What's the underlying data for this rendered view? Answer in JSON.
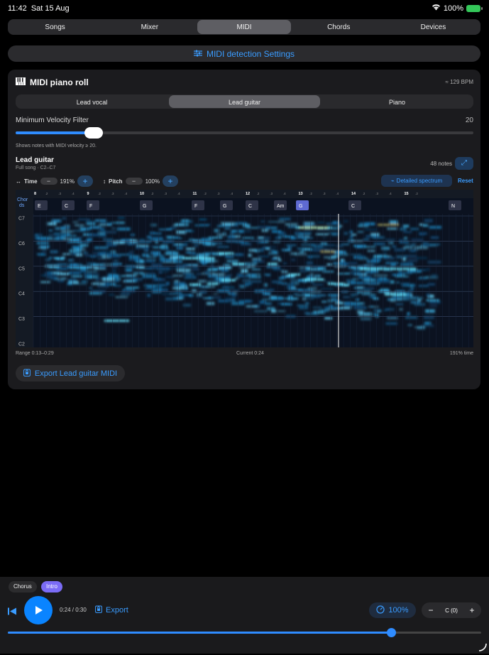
{
  "status": {
    "time": "11:42",
    "date": "Sat 15 Aug",
    "battery": "100%"
  },
  "tabs": [
    "Songs",
    "Mixer",
    "MIDI",
    "Chords",
    "Devices"
  ],
  "active_tab": 2,
  "settings_button": "MIDI detection Settings",
  "panel": {
    "title": "MIDI piano roll",
    "bpm": "≈ 129 BPM",
    "tracks": [
      "Lead vocal",
      "Lead guitar",
      "Piano"
    ],
    "active_track": 1,
    "velocity_label": "Minimum Velocity Filter",
    "velocity_value": "20",
    "velocity_fraction": 0.17,
    "velocity_hint": "Shows notes with MIDI velocity ≥ 20.",
    "track_title": "Lead guitar",
    "track_subtitle": "Full song · C2–C7",
    "notes_count": "48 notes",
    "time_label": "Time",
    "time_zoom": "191%",
    "pitch_label": "Pitch",
    "pitch_zoom": "100%",
    "spectrum_button": "Detailed spectrum",
    "reset_button": "Reset",
    "chords_header": "Chor ds",
    "bar_numbers": [
      "8",
      "9",
      "10",
      "11",
      "12",
      "13",
      "14",
      "15"
    ],
    "beat_labels": [
      ".2",
      ".3",
      ".4"
    ],
    "chords": [
      "E",
      "C",
      "F",
      "G",
      "F",
      "G",
      "C",
      "Am",
      "G",
      "C",
      "N"
    ],
    "active_chord": 8,
    "pitch_labels": [
      "C7",
      "C6",
      "C5",
      "C4",
      "C3",
      "C2"
    ],
    "range_text": "Range 0:13–0:29",
    "current_text": "Current 0:24",
    "time_text": "191% time",
    "export_button": "Export Lead guitar MIDI"
  },
  "sections": [
    "Chorus",
    "Intro"
  ],
  "active_section": 1,
  "transport": {
    "time": "0:24 / 0:30",
    "export": "Export",
    "speed": "100%",
    "key": "C (0)",
    "progress": 0.81
  },
  "colors": {
    "accent": "#0a84ff",
    "active_chord": "#5e6ad2",
    "section_active": "#7b6cf6"
  }
}
